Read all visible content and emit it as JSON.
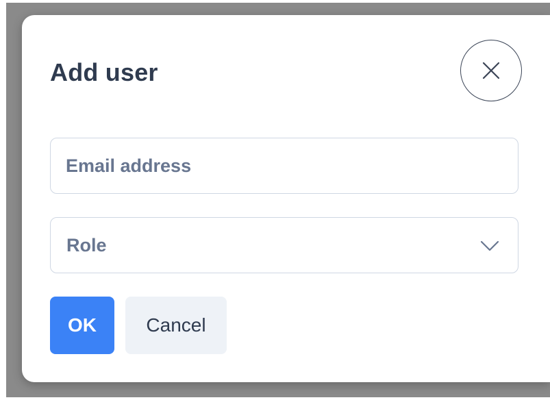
{
  "dialog": {
    "title": "Add user",
    "close_icon": "close-icon"
  },
  "form": {
    "email": {
      "placeholder": "Email address",
      "value": ""
    },
    "role": {
      "label": "Role",
      "icon": "chevron-down-icon"
    }
  },
  "actions": {
    "ok_label": "OK",
    "cancel_label": "Cancel"
  },
  "colors": {
    "primary": "#3b82f6",
    "secondary_bg": "#eef2f7",
    "text": "#2f3b4f",
    "muted": "#687690",
    "border": "#cfd7e3",
    "overlay": "#8a8a8a"
  }
}
